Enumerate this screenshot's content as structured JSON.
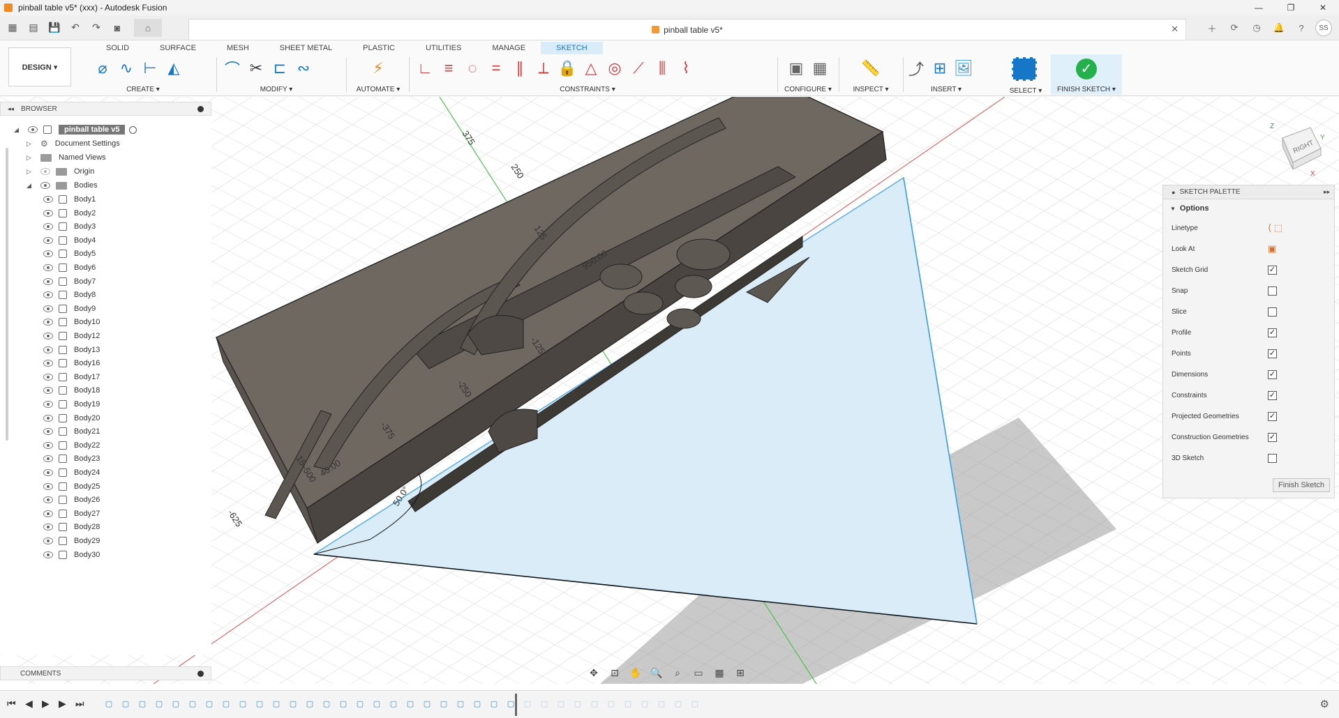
{
  "window": {
    "title": "pinball table v5* (xxx) - Autodesk Fusion",
    "controls": [
      "—",
      "☐",
      "❐",
      "✕"
    ]
  },
  "qabar": {
    "doc_tab": "pinball table v5*",
    "avatar": "SS"
  },
  "ribbon": {
    "tabs": [
      "SOLID",
      "SURFACE",
      "MESH",
      "SHEET METAL",
      "PLASTIC",
      "UTILITIES",
      "MANAGE",
      "SKETCH"
    ],
    "active_tab": "SKETCH",
    "design": "DESIGN ▾",
    "groups": {
      "create": "CREATE ▾",
      "modify": "MODIFY ▾",
      "automate": "AUTOMATE ▾",
      "constraints": "CONSTRAINTS ▾",
      "configure": "CONFIGURE ▾",
      "inspect": "INSPECT ▾",
      "insert": "INSERT ▾",
      "select": "SELECT ▾",
      "finish_sketch": "FINISH SKETCH ▾"
    }
  },
  "browser": {
    "header": "BROWSER",
    "root": "pinball table v5",
    "items": [
      "Document Settings",
      "Named Views",
      "Origin",
      "Bodies"
    ],
    "bodies": [
      "Body1",
      "Body2",
      "Body3",
      "Body4",
      "Body5",
      "Body6",
      "Body7",
      "Body8",
      "Body9",
      "Body10",
      "Body12",
      "Body13",
      "Body16",
      "Body17",
      "Body18",
      "Body19",
      "Body20",
      "Body21",
      "Body22",
      "Body23",
      "Body24",
      "Body25",
      "Body26",
      "Body27",
      "Body28",
      "Body29",
      "Body30"
    ]
  },
  "comments": {
    "header": "COMMENTS"
  },
  "palette": {
    "header": "SKETCH PALETTE",
    "options": "Options",
    "rows": [
      {
        "label": "Linetype",
        "type": "icon"
      },
      {
        "label": "Look At",
        "type": "icon"
      },
      {
        "label": "Sketch Grid",
        "checked": true
      },
      {
        "label": "Snap",
        "checked": false
      },
      {
        "label": "Slice",
        "checked": false
      },
      {
        "label": "Profile",
        "checked": true
      },
      {
        "label": "Points",
        "checked": true
      },
      {
        "label": "Dimensions",
        "checked": true
      },
      {
        "label": "Constraints",
        "checked": true
      },
      {
        "label": "Projected Geometries",
        "checked": true
      },
      {
        "label": "Construction Geometries",
        "checked": true
      },
      {
        "label": "3D Sketch",
        "checked": false
      }
    ],
    "finish": "Finish Sketch"
  },
  "viewcube": {
    "face": "RIGHT",
    "axes": [
      "Z",
      "Y",
      "X"
    ]
  },
  "dimensions": {
    "d375": "375",
    "d250": "250",
    "d125": "125",
    "d950": "950.00",
    "dm125": "-125",
    "dm250": "-250",
    "dm375": "-375",
    "dm500": "-500",
    "dm625": "-625",
    "d40": "40.00",
    "d15": "15",
    "angle": "50.0°"
  },
  "colors": {
    "accent": "#1a78c2",
    "sketch_fill": "#d9ecf8",
    "model": "#6e6860",
    "finish_green": "#24b14b"
  }
}
